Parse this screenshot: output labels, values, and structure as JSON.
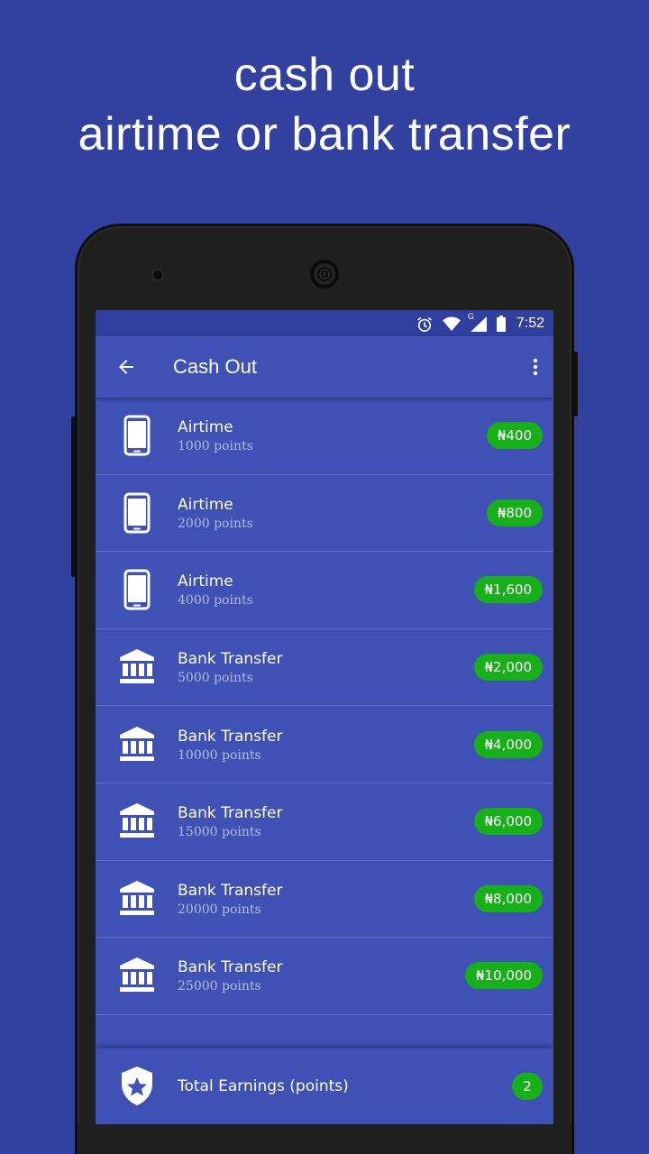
{
  "promo": {
    "line1": "cash out",
    "line2": "airtime or bank transfer"
  },
  "status_bar": {
    "time": "7:52",
    "icons": [
      "alarm-icon",
      "wifi-icon",
      "signal-icon",
      "battery-icon"
    ],
    "network_label": "G"
  },
  "app_bar": {
    "title": "Cash Out",
    "back_icon": "arrow-back-icon",
    "menu_icon": "more-vert-icon"
  },
  "cashout_options": [
    {
      "type": "Airtime",
      "points": "1000 points",
      "amount": "₦400",
      "icon": "phone-icon"
    },
    {
      "type": "Airtime",
      "points": "2000 points",
      "amount": "₦800",
      "icon": "phone-icon"
    },
    {
      "type": "Airtime",
      "points": "4000 points",
      "amount": "₦1,600",
      "icon": "phone-icon"
    },
    {
      "type": "Bank Transfer",
      "points": "5000 points",
      "amount": "₦2,000",
      "icon": "bank-icon"
    },
    {
      "type": "Bank Transfer",
      "points": "10000 points",
      "amount": "₦4,000",
      "icon": "bank-icon"
    },
    {
      "type": "Bank Transfer",
      "points": "15000 points",
      "amount": "₦6,000",
      "icon": "bank-icon"
    },
    {
      "type": "Bank Transfer",
      "points": "20000 points",
      "amount": "₦8,000",
      "icon": "bank-icon"
    },
    {
      "type": "Bank Transfer",
      "points": "25000 points",
      "amount": "₦10,000",
      "icon": "bank-icon"
    }
  ],
  "footer": {
    "label": "Total Earnings (points)",
    "value": "2",
    "icon": "shield-star-icon"
  },
  "colors": {
    "background": "#3240a0",
    "app_primary": "#3f51b5",
    "status_bar": "#303f9f",
    "accent_green": "#17b01a"
  }
}
